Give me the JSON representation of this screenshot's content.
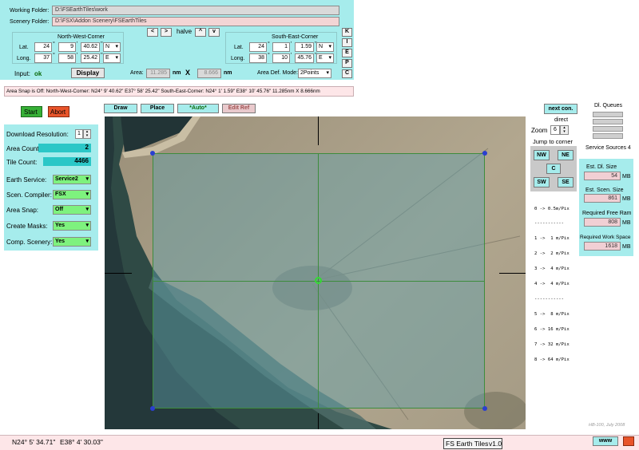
{
  "folders": {
    "working_label": "Working Folder:",
    "working_value": "D:\\FSEarthTiles\\work",
    "scenery_label": "Scenery Folder:",
    "scenery_value": "D:\\FSX\\Addon Scenery\\FSEarthTiles"
  },
  "nw": {
    "title": "North-West-Corner",
    "lat_label": "Lat.",
    "lat_deg": "24",
    "lat_min": "9",
    "lat_sec": "40.62",
    "lat_dir": "N",
    "long_label": "Long.",
    "long_deg": "37",
    "long_min": "58",
    "long_sec": "25.42",
    "long_dir": "E"
  },
  "se": {
    "title": "South-East-Corner",
    "lat_label": "Lat.",
    "lat_deg": "24",
    "lat_min": "1",
    "lat_sec": "1.59",
    "lat_dir": "N",
    "long_label": "Long.",
    "long_deg": "38",
    "long_min": "10",
    "long_sec": "45.76",
    "long_dir": "E"
  },
  "symbols": {
    "deg": "°",
    "min": "'",
    "sec": "''"
  },
  "nav": {
    "left": "<",
    "right": ">",
    "halve": "halve",
    "up": "^",
    "down": "v"
  },
  "side_keys": [
    "K",
    "I",
    "E",
    "P",
    "C"
  ],
  "input": {
    "label": "Input:",
    "status": "ok",
    "display_button": "Display",
    "area_label": "Area:",
    "area_w": "11.285",
    "nm1": "nm",
    "x": "X",
    "area_h": "8.666",
    "nm2": "nm",
    "mode_label": "Area Def. Mode:",
    "mode_value": "2Points"
  },
  "status_line": "Area Snap is Off:   North-West-Corner: N24° 9' 40.62\"   E37° 58' 25.42\"    South-East-Corner: N24° 1' 1.59\"   E38° 10' 45.76\"    11.285nm X 8.666nm",
  "actions": {
    "start": "Start",
    "abort": "Abort"
  },
  "map_buttons": {
    "draw": "Draw",
    "place": "Place",
    "auto": "*Auto*",
    "edit_ref": "Edit Ref"
  },
  "settings": {
    "download_res_label": "Download Resolution:",
    "download_res_value": "1",
    "area_count_label": "Area Count:",
    "area_count_value": "2",
    "tile_count_label": "Tile Count:",
    "tile_count_value": "4466",
    "earth_service_label": "Earth Service:",
    "earth_service_value": "Service2",
    "compiler_label": "Scen. Compiler:",
    "compiler_value": "FSX",
    "area_snap_label": "Area Snap:",
    "area_snap_value": "Off",
    "create_masks_label": "Create Masks:",
    "create_masks_value": "Yes",
    "comp_scenery_label": "Comp. Scenery:",
    "comp_scenery_value": "Yes"
  },
  "right": {
    "next_con": "next con.",
    "direct": "direct",
    "zoom_label": "Zoom",
    "zoom_value": "6",
    "jump_label": "Jump to corner",
    "nw": "NW",
    "ne": "NE",
    "c": "C",
    "sw": "SW",
    "se": "SE",
    "scale_lines": [
      "0 -> 0.5m/Pix",
      "-----------",
      "1 ->  1 m/Pix",
      "2 ->  2 m/Pix",
      "3 ->  4 m/Pix",
      "4 ->  4 m/Pix",
      "-----------",
      "5 ->  8 m/Pix",
      "6 -> 16 m/Pix",
      "7 -> 32 m/Pix",
      "8 -> 64 m/Pix"
    ]
  },
  "queues": {
    "title": "Dl. Queues",
    "sources": "Service Sources 4"
  },
  "estimates": {
    "dl_size_label": "Est. Dl. Size",
    "dl_size_value": "54",
    "dl_unit": "MB",
    "scen_size_label": "Est. Scen. Size",
    "scen_size_value": "861",
    "scen_unit": "MB",
    "ram_label": "Required Free Ram",
    "ram_value": "808",
    "ram_unit": "MB",
    "workspace_label": "Required Work Space",
    "workspace_value": "1618",
    "workspace_unit": "MB"
  },
  "footer": {
    "lat": "N24° 5' 34.71\"",
    "long": "E38° 4' 30.03\"",
    "app_title": "FS Earth Tiles",
    "version": "v1.0",
    "credit": "HB-100,  July 2008",
    "www": "www"
  }
}
